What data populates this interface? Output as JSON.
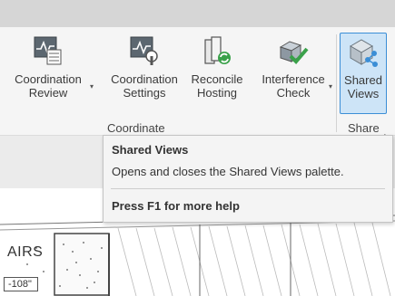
{
  "ribbon": {
    "tools": [
      {
        "id": "coordination-review",
        "lines": [
          "Coordination",
          "Review"
        ],
        "has_dropdown": true,
        "icon": "coordination-review-icon"
      },
      {
        "id": "coordination-settings",
        "lines": [
          "Coordination",
          "Settings"
        ],
        "has_dropdown": false,
        "icon": "coordination-settings-icon"
      },
      {
        "id": "reconcile-hosting",
        "lines": [
          "Reconcile",
          "Hosting"
        ],
        "has_dropdown": false,
        "icon": "reconcile-hosting-icon"
      },
      {
        "id": "interference-check",
        "lines": [
          "Interference",
          "Check"
        ],
        "has_dropdown": true,
        "icon": "interference-check-icon"
      },
      {
        "id": "shared-views",
        "lines": [
          "Shared",
          "Views"
        ],
        "has_dropdown": false,
        "icon": "shared-views-icon",
        "state": "hover"
      }
    ],
    "dropdown_glyph": "▾",
    "panels": {
      "coordinate": "Coordinate",
      "share": "Share"
    }
  },
  "tooltip": {
    "title": "Shared Views",
    "description": "Opens and closes the Shared Views palette.",
    "help": "Press F1 for more help"
  },
  "drawing": {
    "room_label": "AIRS",
    "elevation_tag": "-108\""
  },
  "colors": {
    "accent": "#3b8ed6",
    "hover_fill": "#cde4f7",
    "icon_green": "#3aa14a"
  }
}
